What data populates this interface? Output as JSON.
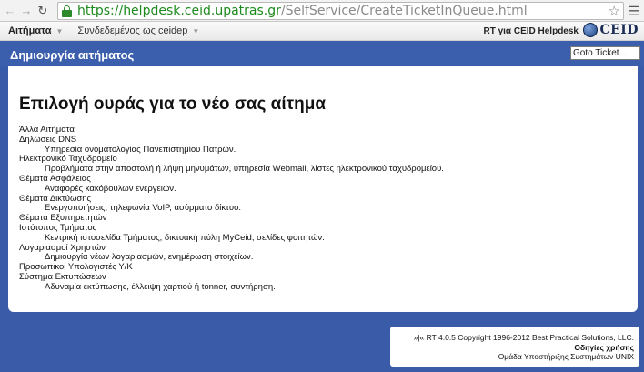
{
  "browser": {
    "url_protocol": "https://",
    "url_host": "helpdesk.ceid.upatras.gr",
    "url_path": "/SelfService/CreateTicketInQueue.html"
  },
  "topmenu": {
    "items": [
      {
        "label": "Αιτήματα"
      },
      {
        "label": "Συνδεδεμένος ως ceidep"
      }
    ],
    "rt_label": "RT για CEID Helpdesk",
    "logo_text": "CEID"
  },
  "header": {
    "title": "Δημιουργία αιτήματος",
    "goto_value": "Goto Ticket..."
  },
  "main": {
    "heading": "Επιλογή ουράς για το νέο σας αίτημα",
    "queues": [
      {
        "name": "Άλλα Αιτήματα",
        "desc": ""
      },
      {
        "name": "Δηλώσεις DNS",
        "desc": "Υπηρεσία ονοματολογίας Πανεπιστημίου Πατρών."
      },
      {
        "name": "Ηλεκτρονικό Ταχυδρομείο",
        "desc": "Προβλήματα στην αποστολή ή λήψη μηνυμάτων, υπηρεσία Webmail, λίστες ηλεκτρονικού ταχυδρομείου."
      },
      {
        "name": "Θέματα Ασφάλειας",
        "desc": "Αναφορές κακόβουλων ενεργειών."
      },
      {
        "name": "Θέματα Δικτύωσης",
        "desc": "Ενεργοποιήσεις, τηλεφωνία VoIP, ασύρματο δίκτυο."
      },
      {
        "name": "Θέματα Εξυπηρετητών",
        "desc": ""
      },
      {
        "name": "Ιστότοπος Τμήματος",
        "desc": "Κεντρική ιστοσελίδα Τμήματος, δικτυακή πύλη MyCeid, σελίδες φοιτητών."
      },
      {
        "name": "Λογαριασμοί Χρηστών",
        "desc": "Δημιουργία νέων λογαριασμών, ενημέρωση στοιχείων."
      },
      {
        "name": "Προσωπικοί Υπολογιστές Υ/Κ",
        "desc": ""
      },
      {
        "name": "Σύστημα Εκτυπώσεων",
        "desc": "Αδυναμία εκτύπωσης, έλλειψη χαρτιού ή tonner, συντήρηση."
      }
    ]
  },
  "footer": {
    "copyright": "»|« RT 4.0.5 Copyright 1996-2012 Best Practical Solutions, LLC.",
    "guide_link": "Οδηγίες χρήσης",
    "team": "Ομάδα Υποστήριξης Συστημάτων UNIX"
  }
}
